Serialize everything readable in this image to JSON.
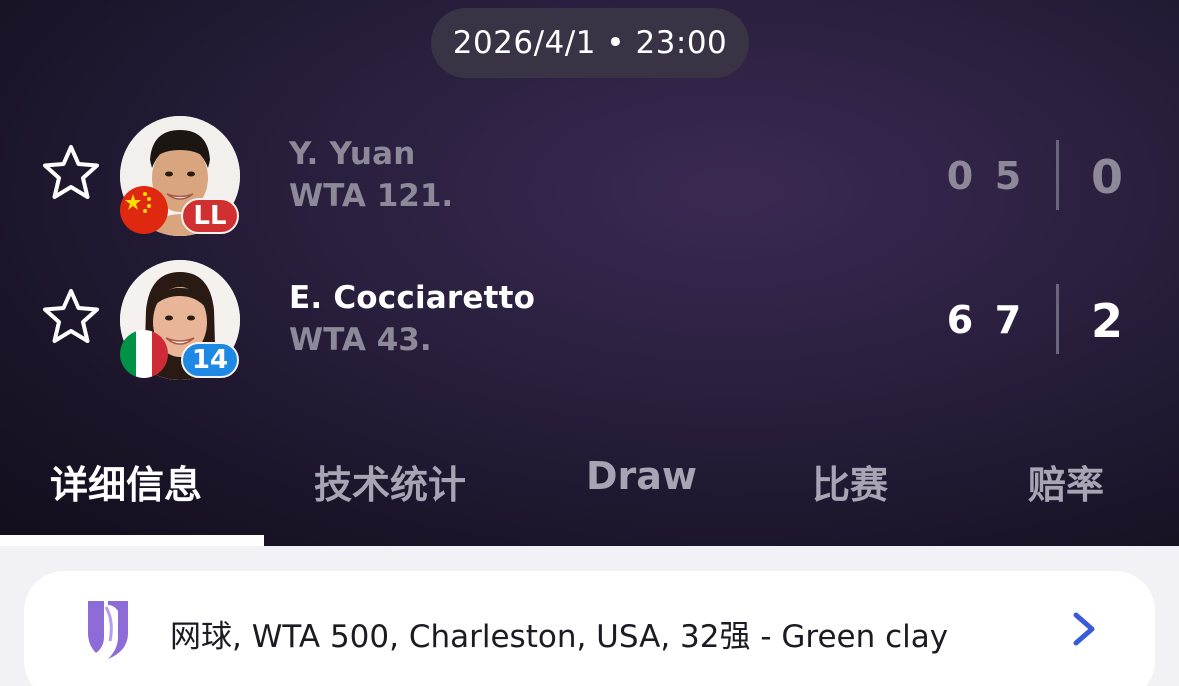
{
  "match": {
    "datetime": "2026/4/1 • 23:00"
  },
  "players": [
    {
      "name": "Y. Yuan",
      "rank": "WTA 121.",
      "badge": "LL",
      "country_flag": "china-flag",
      "sets": [
        "0",
        "5"
      ],
      "total": "0",
      "status": "loser"
    },
    {
      "name": "E. Cocciaretto",
      "rank": "WTA 43.",
      "badge": "14",
      "country_flag": "italy-flag",
      "sets": [
        "6",
        "7"
      ],
      "total": "2",
      "status": "winner"
    }
  ],
  "tabs": [
    {
      "label": "详细信息",
      "active": true
    },
    {
      "label": "技术统计",
      "active": false
    },
    {
      "label": "Draw",
      "active": false
    },
    {
      "label": "比赛",
      "active": false
    },
    {
      "label": "赔率",
      "active": false
    }
  ],
  "tournament": {
    "label": "网球, WTA 500, Charleston, USA, 32强 - Green clay",
    "icon": "wta-logo-icon"
  },
  "colors": {
    "header_bg": "#1a1428",
    "muted_text": "#8d8999",
    "ll_badge": "#d0302f",
    "seed_badge": "#1e88e5",
    "tour_icon": "#8e6cd8",
    "chevron": "#3a5bd9"
  }
}
